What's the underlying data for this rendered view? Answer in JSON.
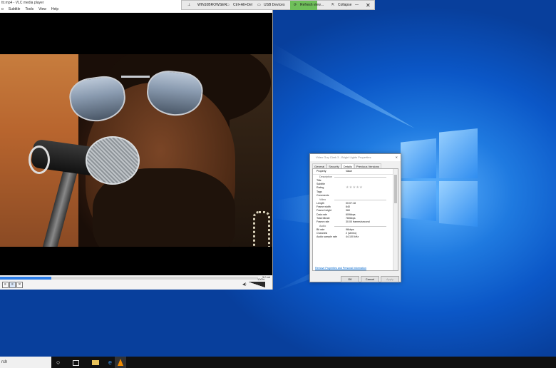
{
  "vlc": {
    "title": "ttr.mp4 - VLC media player",
    "menu": [
      "o",
      "Subtitle",
      "Tools",
      "View",
      "Help"
    ],
    "time": "3:0 ab",
    "volume_pct": "100%",
    "progress": 0.2
  },
  "remote_bar": {
    "machine": "WIN10BROWSER",
    "ctrl_alt_del": "Ctrl+Alt+Del",
    "usb": "USB Devices",
    "refresh": "Refresh view",
    "more": "...",
    "collapse": "Collapse"
  },
  "dialog": {
    "title": "Video Guy Clark 3 - Bright Lights Properties",
    "tabs": [
      "General",
      "Security",
      "Details",
      "Previous Versions"
    ],
    "active_tab": "Details",
    "columns": [
      "Property",
      "Value"
    ],
    "sections": {
      "description": "Description",
      "video": "Video",
      "audio": "Audio"
    },
    "description_rows": [
      "Title",
      "Subtitle",
      "Rating",
      "Tags",
      "Comments"
    ],
    "video_rows": [
      {
        "label": "Length",
        "value": "00:07:18"
      },
      {
        "label": "Frame width",
        "value": "640"
      },
      {
        "label": "Frame height",
        "value": "360"
      },
      {
        "label": "Data rate",
        "value": "609kbps"
      },
      {
        "label": "Total bitrate",
        "value": "760kbps"
      },
      {
        "label": "Frame rate",
        "value": "30.00 frames/second"
      }
    ],
    "audio_rows": [
      {
        "label": "Bit rate",
        "value": "96kbps"
      },
      {
        "label": "Channels",
        "value": "2 (stereo)"
      },
      {
        "label": "Audio sample rate",
        "value": "44.100 kHz"
      }
    ],
    "rating_stars": "★★★★★",
    "link": "Remove Properties and Personal Information",
    "ok": "OK",
    "cancel": "Cancel",
    "apply": "Apply"
  },
  "taskbar": {
    "search_placeholder": "rch"
  }
}
